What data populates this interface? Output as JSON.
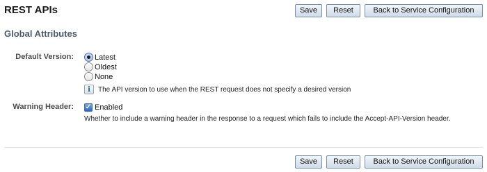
{
  "header": {
    "title": "REST APIs"
  },
  "buttons": {
    "save": "Save",
    "reset": "Reset",
    "back": "Back to Service Configuration"
  },
  "section": {
    "title": "Global Attributes"
  },
  "default_version": {
    "label": "Default Version:",
    "options": [
      "Latest",
      "Oldest",
      "None"
    ],
    "selected": "Latest",
    "help": "The API version to use when the REST request does not specify a desired version"
  },
  "warning_header": {
    "label": "Warning Header:",
    "checkbox_label": "Enabled",
    "checked": true,
    "description": "Whether to include a warning header in the response to a request which fails to include the Accept-API-Version header."
  },
  "icons": {
    "info": "info-icon",
    "check": "checkmark-icon"
  }
}
